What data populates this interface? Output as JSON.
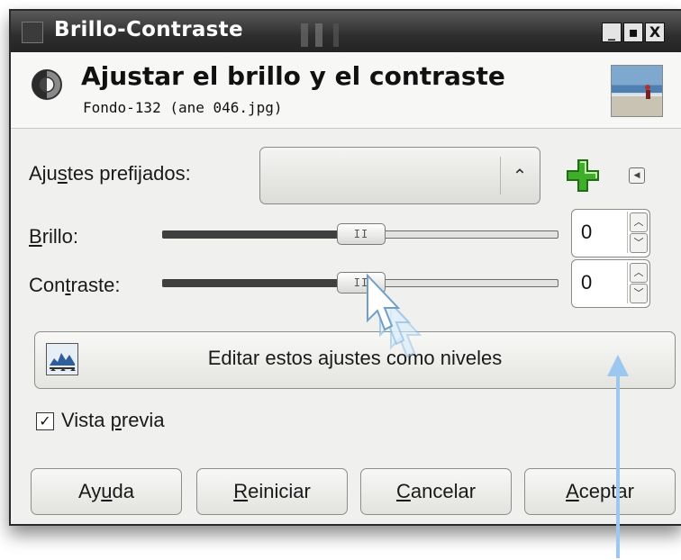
{
  "window": {
    "title": "Brillo-Contraste",
    "controls": {
      "minimize": "_",
      "maximize": "▪",
      "close": "X"
    }
  },
  "header": {
    "title": "Ajustar el brillo y el contraste",
    "subtitle": "Fondo-132 (ane 046.jpg)",
    "icon": "brightness-contrast-icon",
    "thumbnail": "image-thumbnail"
  },
  "presets": {
    "label_pre": "Aju",
    "label_mnemonic": "s",
    "label_post": "tes prefijados:",
    "value": "",
    "add_icon": "plus-icon",
    "menu_icon": "left-arrow-icon"
  },
  "brightness": {
    "label_mnemonic": "B",
    "label_post": "rillo:",
    "value": "0",
    "slider_fraction": 0.5
  },
  "contrast": {
    "label_pre": "Con",
    "label_mnemonic": "t",
    "label_post": "raste:",
    "value": "0",
    "slider_fraction": 0.5
  },
  "levels_button": {
    "label": "Editar estos ajustes como niveles",
    "icon": "levels-icon"
  },
  "preview": {
    "checked": true,
    "check_glyph": "✓",
    "label_pre": "Vista ",
    "label_mnemonic": "p",
    "label_post": "revia"
  },
  "buttons": {
    "help": {
      "pre": "Ay",
      "mnemonic": "u",
      "post": "da"
    },
    "reset": {
      "pre": "",
      "mnemonic": "R",
      "post": "einiciar"
    },
    "cancel": {
      "pre": "",
      "mnemonic": "C",
      "post": "ancelar"
    },
    "accept": {
      "pre": "",
      "mnemonic": "A",
      "post": "ceptar"
    }
  },
  "colors": {
    "annotation_arrow": "#9cc8f0",
    "plus_icon": "#3fae2a"
  }
}
